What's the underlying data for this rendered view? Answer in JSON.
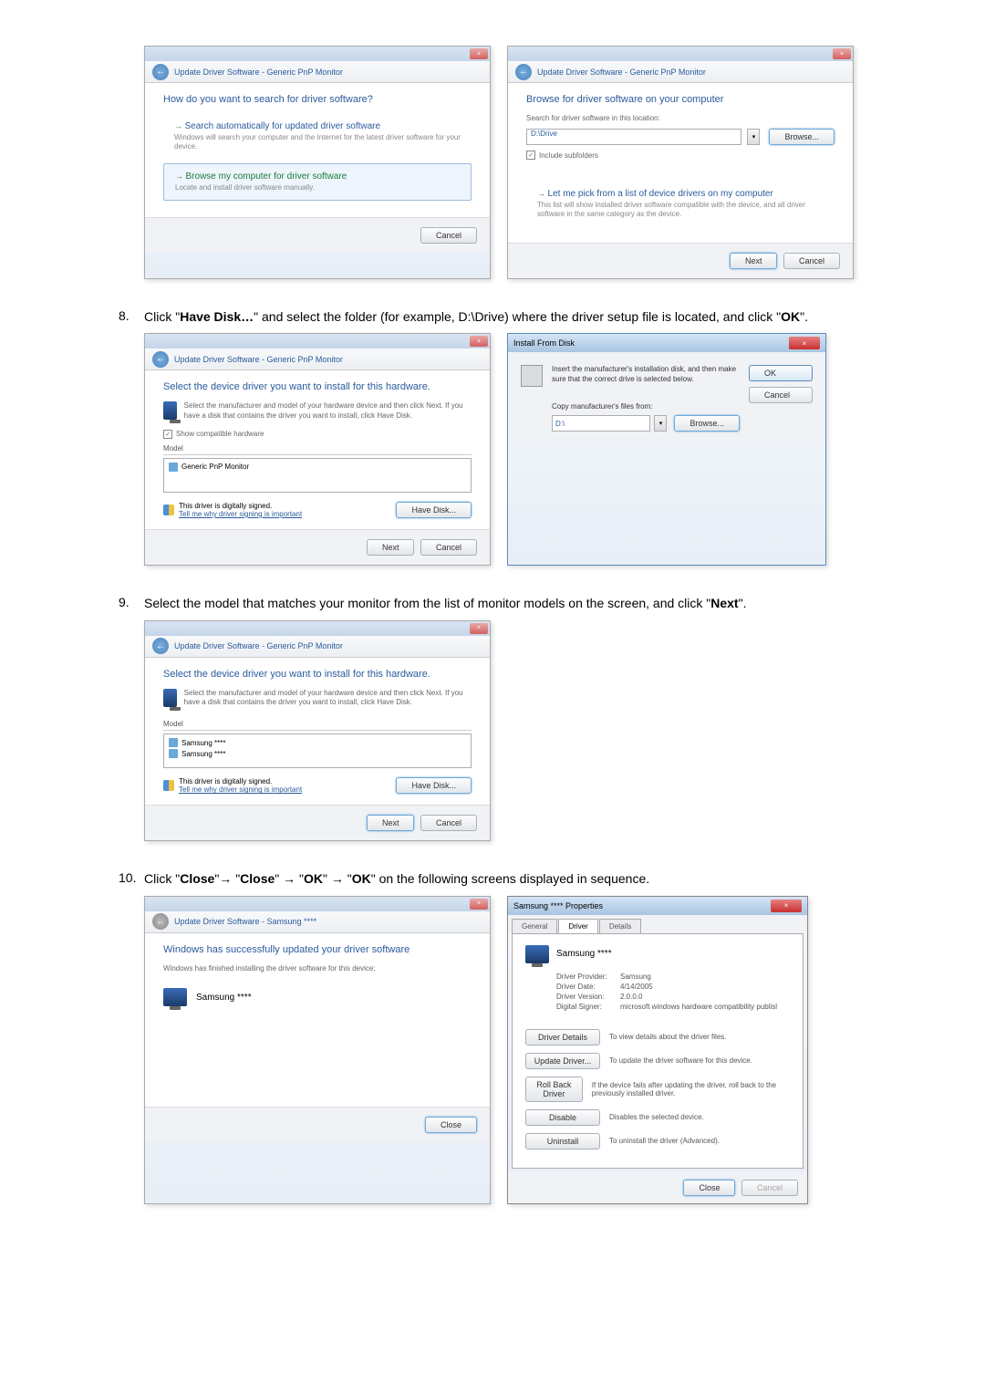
{
  "step8": {
    "num": "8.",
    "text_a": "Click \"",
    "text_b": "Have Disk…",
    "text_c": "\" and select the folder (for example, D:\\Drive) where the driver setup file is located, and click \"",
    "text_d": "OK",
    "text_e": "\"."
  },
  "step9": {
    "num": "9.",
    "text_a": "Select the model that matches your monitor from the list of monitor models on the screen, and click \"",
    "text_b": "Next",
    "text_c": "\"."
  },
  "step10": {
    "num": "10.",
    "text_a": "Click \"",
    "text_b": "Close",
    "text_c": "\"→ \"",
    "text_d": "Close",
    "text_e": "\" → \"",
    "text_f": "OK",
    "text_g": "\" → \"",
    "text_h": "OK",
    "text_i": "\" on the following screens displayed in sequence."
  },
  "dlg1": {
    "bar": "Update Driver Software - Generic PnP Monitor",
    "hdr": "How do you want to search for driver software?",
    "opt1_t": "Search automatically for updated driver software",
    "opt1_d": "Windows will search your computer and the Internet for the latest driver software for your device.",
    "opt2_t": "Browse my computer for driver software",
    "opt2_d": "Locate and install driver software manually.",
    "cancel": "Cancel"
  },
  "dlg2": {
    "bar": "Update Driver Software - Generic PnP Monitor",
    "hdr": "Browse for driver software on your computer",
    "lbl": "Search for driver software in this location:",
    "path": "D:\\Drive",
    "browse": "Browse...",
    "chk": "Include subfolders",
    "opt_t": "Let me pick from a list of device drivers on my computer",
    "opt_d": "This list will show installed driver software compatible with the device, and all driver software in the same category as the device.",
    "next": "Next",
    "cancel": "Cancel"
  },
  "dlg3": {
    "bar": "Update Driver Software - Generic PnP Monitor",
    "hdr": "Select the device driver you want to install for this hardware.",
    "sub": "Select the manufacturer and model of your hardware device and then click Next. If you have a disk that contains the driver you want to install, click Have Disk.",
    "compat": "Show compatible hardware",
    "model_hdr": "Model",
    "model": "Generic PnP Monitor",
    "sig": "This driver is digitally signed.",
    "siglink": "Tell me why driver signing is important",
    "havedisk": "Have Disk...",
    "next": "Next",
    "cancel": "Cancel"
  },
  "ifd": {
    "title": "Install From Disk",
    "msg": "Insert the manufacturer's installation disk, and then make sure that the correct drive is selected below.",
    "ok": "OK",
    "cancel": "Cancel",
    "copy": "Copy manufacturer's files from:",
    "path": "D:\\",
    "browse": "Browse..."
  },
  "dlg5": {
    "bar": "Update Driver Software - Generic PnP Monitor",
    "hdr": "Select the device driver you want to install for this hardware.",
    "sub": "Select the manufacturer and model of your hardware device and then click Next. If you have a disk that contains the driver you want to install, click Have Disk.",
    "model_hdr": "Model",
    "m1": "Samsung ****",
    "m2": "Samsung ****",
    "sig": "This driver is digitally signed.",
    "siglink": "Tell me why driver signing is important",
    "havedisk": "Have Disk...",
    "next": "Next",
    "cancel": "Cancel"
  },
  "dlg6": {
    "bar": "Update Driver Software - Samsung ****",
    "hdr": "Windows has successfully updated your driver software",
    "sub": "Windows has finished installing the driver software for this device:",
    "model": "Samsung ****",
    "close": "Close"
  },
  "prop": {
    "title": "Samsung **** Properties",
    "tab1": "General",
    "tab2": "Driver",
    "tab3": "Details",
    "name": "Samsung ****",
    "lbl_prov": "Driver Provider:",
    "prov": "Samsung",
    "lbl_date": "Driver Date:",
    "date": "4/14/2005",
    "lbl_ver": "Driver Version:",
    "ver": "2.0.0.0",
    "lbl_sig": "Digital Signer:",
    "sig": "microsoft windows hardware compatibility publisl",
    "b1": "Driver Details",
    "b1d": "To view details about the driver files.",
    "b2": "Update Driver...",
    "b2d": "To update the driver software for this device.",
    "b3": "Roll Back Driver",
    "b3d": "If the device fails after updating the driver, roll back to the previously installed driver.",
    "b4": "Disable",
    "b4d": "Disables the selected device.",
    "b5": "Uninstall",
    "b5d": "To uninstall the driver (Advanced).",
    "close": "Close",
    "cancel": "Cancel"
  }
}
